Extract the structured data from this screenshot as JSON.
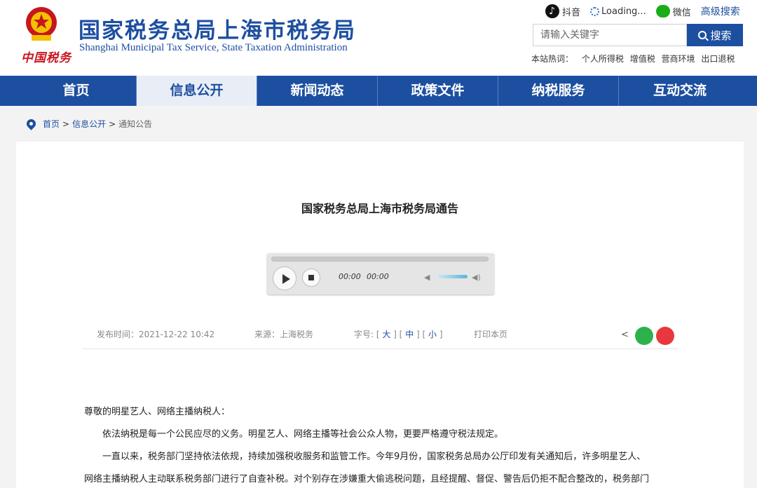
{
  "header": {
    "title": "国家税务总局上海市税务局",
    "subtitle": "Shanghai Municipal Tax Service, State Taxation Administration",
    "logo_text": "中国税务",
    "top_links": {
      "douyin": "抖音",
      "loading": "Loading...",
      "wechat": "微信",
      "advanced_search": "高级搜索"
    },
    "search": {
      "placeholder": "请输入关键字",
      "button": "搜索"
    },
    "hot": {
      "label": "本站热词：",
      "items": [
        "个人所得税",
        "增值税",
        "营商环境",
        "出口退税"
      ]
    }
  },
  "nav": {
    "items": [
      "首页",
      "信息公开",
      "新闻动态",
      "政策文件",
      "纳税服务",
      "互动交流"
    ],
    "active_index": 1
  },
  "breadcrumb": {
    "items": [
      "首页",
      "信息公开"
    ],
    "current": "通知公告",
    "separator": ">"
  },
  "article": {
    "title": "国家税务总局上海市税务局通告",
    "player": {
      "current_time": "00:00",
      "duration": "00:00"
    },
    "meta": {
      "publish": "发布时间：2021-12-22 10:42",
      "source": "来源：上海税务",
      "font_label": "字号:",
      "font_large": "大",
      "font_medium": "中",
      "font_small": "小",
      "print": "打印本页"
    },
    "paragraphs": [
      "尊敬的明星艺人、网络主播纳税人：",
      "依法纳税是每一个公民应尽的义务。明星艺人、网络主播等社会公众人物，更要严格遵守税法规定。",
      "一直以来，税务部门坚持依法依规，持续加强税收服务和监管工作。今年9月份，国家税务总局办公厅印发有关通知后，许多明星艺人、",
      "网络主播纳税人主动联系税务部门进行了自查补税。对个别存在涉嫌重大偷逃税问题，且经提醒、督促、警告后仍拒不配合整改的，税务部门"
    ]
  },
  "colors": {
    "brand": "#1d4fa0",
    "emblem_red": "#c8161d",
    "wechat": "#2bb24c",
    "weibo": "#e8383d"
  }
}
